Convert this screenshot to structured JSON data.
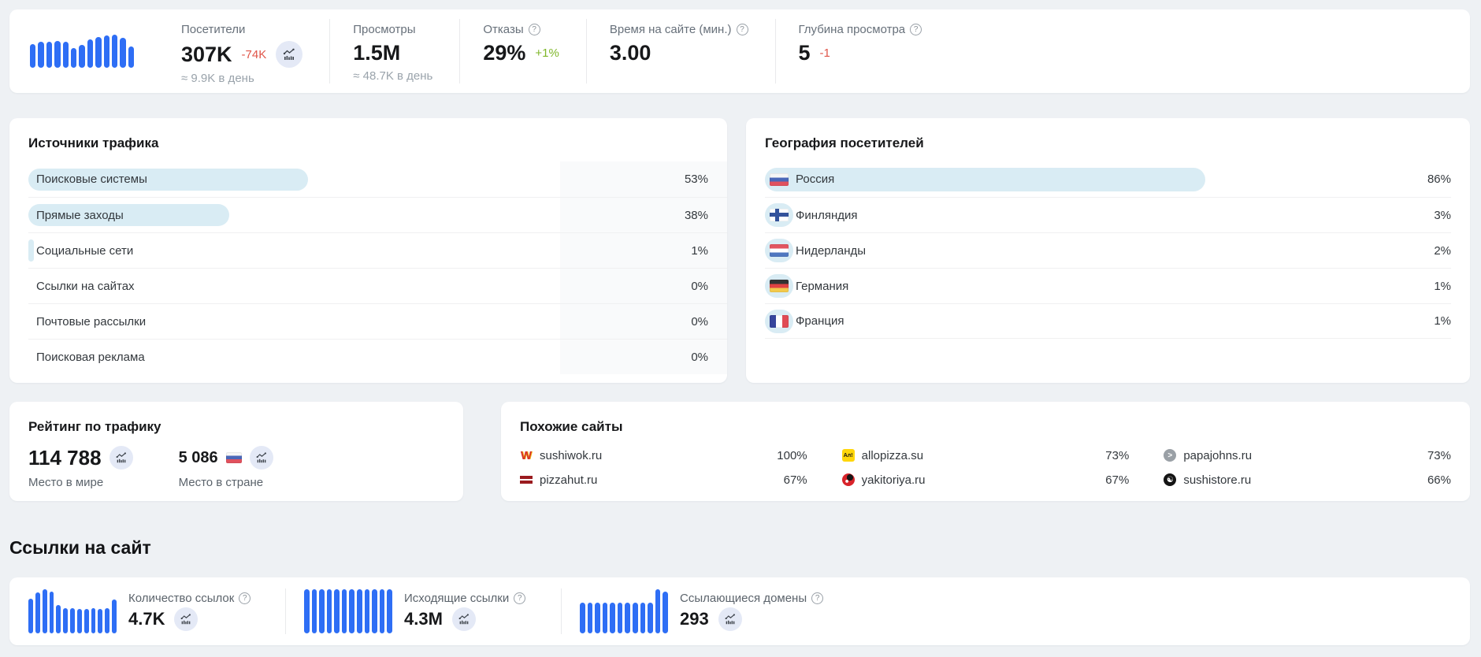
{
  "topbar": {
    "sparkline_bars": [
      0.72,
      0.78,
      0.78,
      0.8,
      0.78,
      0.6,
      0.68,
      0.86,
      0.94,
      0.97,
      1.0,
      0.9,
      0.64
    ],
    "visitors": {
      "label": "Посетители",
      "value": "307K",
      "delta": "-74K",
      "sub": "≈ 9.9K в день"
    },
    "views": {
      "label": "Просмотры",
      "value": "1.5M",
      "sub": "≈ 48.7K в день"
    },
    "bounces": {
      "label": "Отказы",
      "value": "29%",
      "delta": "+1%"
    },
    "time_on_site": {
      "label": "Время на сайте (мин.)",
      "value": "3.00"
    },
    "depth": {
      "label": "Глубина просмотра",
      "value": "5",
      "delta": "-1"
    }
  },
  "traffic_sources": {
    "title": "Источники трафика",
    "rows": [
      {
        "label": "Поисковые системы",
        "pct": 53,
        "pct_label": "53%"
      },
      {
        "label": "Прямые заходы",
        "pct": 38,
        "pct_label": "38%"
      },
      {
        "label": "Социальные сети",
        "pct": 1,
        "pct_label": "1%"
      },
      {
        "label": "Ссылки на сайтах",
        "pct": 0,
        "pct_label": "0%"
      },
      {
        "label": "Почтовые рассылки",
        "pct": 0,
        "pct_label": "0%"
      },
      {
        "label": "Поисковая реклама",
        "pct": 0,
        "pct_label": "0%"
      }
    ]
  },
  "geography": {
    "title": "География посетителей",
    "rows": [
      {
        "country": "Россия",
        "flag": "ru",
        "pct": 86,
        "pct_label": "86%"
      },
      {
        "country": "Финляндия",
        "flag": "fi",
        "pct": 3,
        "pct_label": "3%"
      },
      {
        "country": "Нидерланды",
        "flag": "nl",
        "pct": 2,
        "pct_label": "2%"
      },
      {
        "country": "Германия",
        "flag": "de",
        "pct": 1,
        "pct_label": "1%"
      },
      {
        "country": "Франция",
        "flag": "fr",
        "pct": 1,
        "pct_label": "1%"
      }
    ]
  },
  "rank": {
    "title": "Рейтинг по трафику",
    "world": {
      "value": "114 788",
      "label": "Место в мире"
    },
    "country": {
      "value": "5 086",
      "label": "Место в стране",
      "flag": "ru"
    }
  },
  "similar": {
    "title": "Похожие сайты",
    "sites": [
      {
        "domain": "sushiwok.ru",
        "pct_label": "100%",
        "icon": "sushiwok"
      },
      {
        "domain": "allopizza.su",
        "pct_label": "73%",
        "icon": "allopizza"
      },
      {
        "domain": "papajohns.ru",
        "pct_label": "73%",
        "icon": "papajohns"
      },
      {
        "domain": "pizzahut.ru",
        "pct_label": "67%",
        "icon": "pizzahut"
      },
      {
        "domain": "yakitoriya.ru",
        "pct_label": "67%",
        "icon": "yakitoriya"
      },
      {
        "domain": "sushistore.ru",
        "pct_label": "66%",
        "icon": "sushistore"
      }
    ]
  },
  "links": {
    "heading": "Ссылки на сайт",
    "metrics": [
      {
        "label": "Количество ссылок",
        "value": "4.7K",
        "bars": [
          0.78,
          0.92,
          1.0,
          0.94,
          0.64,
          0.58,
          0.58,
          0.56,
          0.56,
          0.58,
          0.56,
          0.58,
          0.76
        ]
      },
      {
        "label": "Исходящие ссылки",
        "value": "4.3M",
        "bars": [
          1,
          1,
          1,
          1,
          1,
          1,
          1,
          1,
          1,
          1,
          1,
          1
        ]
      },
      {
        "label": "Ссылающиеся домены",
        "value": "293",
        "bars": [
          0.7,
          0.7,
          0.7,
          0.7,
          0.7,
          0.7,
          0.7,
          0.7,
          0.7,
          0.7,
          1.0,
          0.94
        ]
      }
    ]
  },
  "colors": {
    "accent_blue": "#2e6ef5",
    "pill_blue": "#d9ecf4",
    "negative_red": "#e0564a",
    "positive_green": "#7fb72a"
  }
}
